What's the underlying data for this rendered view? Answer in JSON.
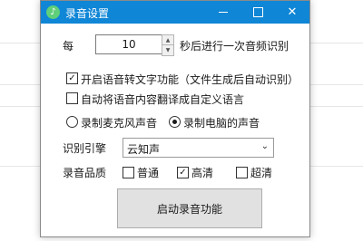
{
  "window": {
    "title": "录音设置"
  },
  "interval": {
    "prefix": "每",
    "value": "10",
    "suffix": "秒后进行一次音频识别"
  },
  "options": {
    "speech_to_text": {
      "label": "开启语音转文字功能（文件生成后自动识别）",
      "checked": true
    },
    "translate": {
      "label": "自动将语音内容翻译成自定义语言",
      "checked": false
    }
  },
  "source": {
    "mic_label": "录制麦克风声音",
    "system_label": "录制电脑的声音",
    "selected": "system"
  },
  "engine": {
    "label": "识别引擎",
    "value": "云知声"
  },
  "quality": {
    "label": "录音品质",
    "options": [
      {
        "label": "普通",
        "checked": false
      },
      {
        "label": "高清",
        "checked": true
      },
      {
        "label": "超清",
        "checked": false
      }
    ]
  },
  "start_button": {
    "label": "启动录音功能"
  },
  "glyphs": {
    "check": "✓",
    "up": "▲",
    "down": "▼",
    "dropdown": "⌄",
    "close": "✕",
    "app": "♪"
  }
}
